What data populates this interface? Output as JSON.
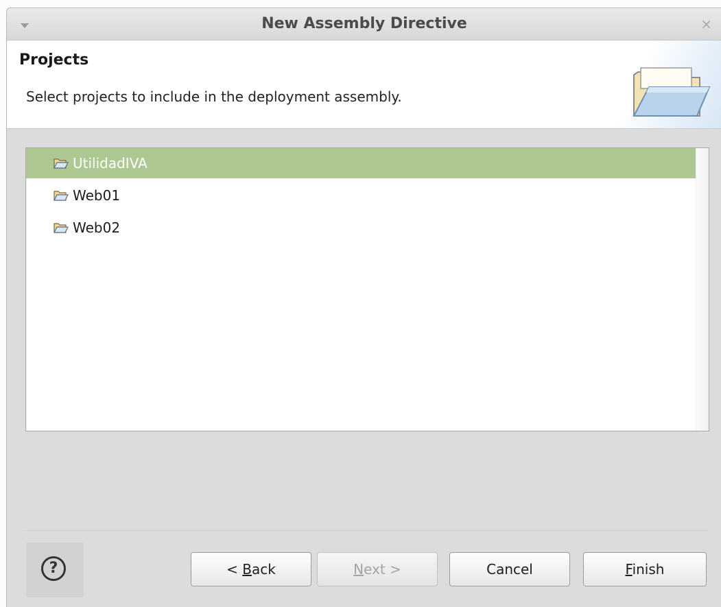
{
  "window": {
    "title": "New Assembly Directive",
    "close_glyph": "×"
  },
  "header": {
    "title": "Projects",
    "description": "Select projects to include in the deployment assembly.",
    "banner_icon": "folder-open-icon"
  },
  "projects": {
    "items": [
      {
        "label": "UtilidadIVA",
        "icon": "project-folder-icon",
        "selected": true
      },
      {
        "label": "Web01",
        "icon": "project-folder-icon",
        "selected": false
      },
      {
        "label": "Web02",
        "icon": "project-folder-icon",
        "selected": false
      }
    ],
    "selected_color": "#aec892"
  },
  "buttons": {
    "help_glyph": "?",
    "back": {
      "prefix": "< ",
      "mnemonic": "B",
      "rest": "ack"
    },
    "next": {
      "mnemonic": "N",
      "rest": "ext >",
      "enabled": false
    },
    "cancel": {
      "label": "Cancel"
    },
    "finish": {
      "mnemonic": "F",
      "rest": "inish"
    }
  }
}
